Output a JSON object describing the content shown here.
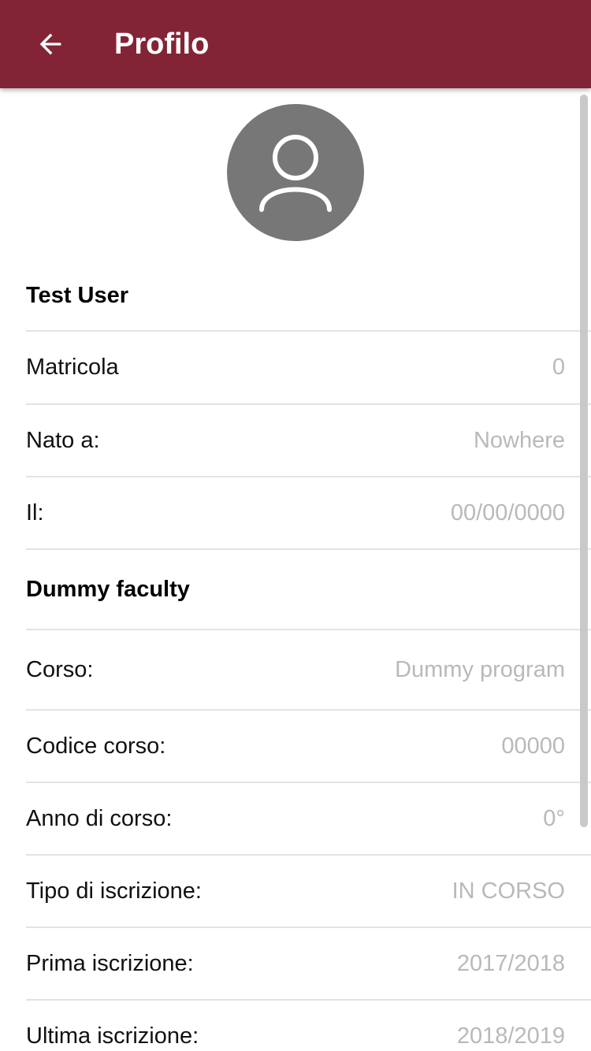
{
  "appbar": {
    "title": "Profilo",
    "back_icon": "arrow-left-icon",
    "color": "#832436"
  },
  "profile": {
    "avatar_icon": "person-icon",
    "name": "Test User",
    "fields": [
      {
        "label": "Matricola",
        "value": "0"
      },
      {
        "label": "Nato a:",
        "value": "Nowhere"
      },
      {
        "label": "Il:",
        "value": "00/00/0000"
      }
    ]
  },
  "faculty": {
    "name": "Dummy faculty",
    "fields": [
      {
        "label": "Corso:",
        "value": "Dummy program"
      },
      {
        "label": "Codice corso:",
        "value": "00000"
      },
      {
        "label": "Anno di corso:",
        "value": "0°"
      },
      {
        "label": "Tipo di iscrizione:",
        "value": "IN CORSO"
      },
      {
        "label": "Prima iscrizione:",
        "value": "2017/2018"
      },
      {
        "label": "Ultima iscrizione:",
        "value": "2018/2019"
      }
    ]
  }
}
